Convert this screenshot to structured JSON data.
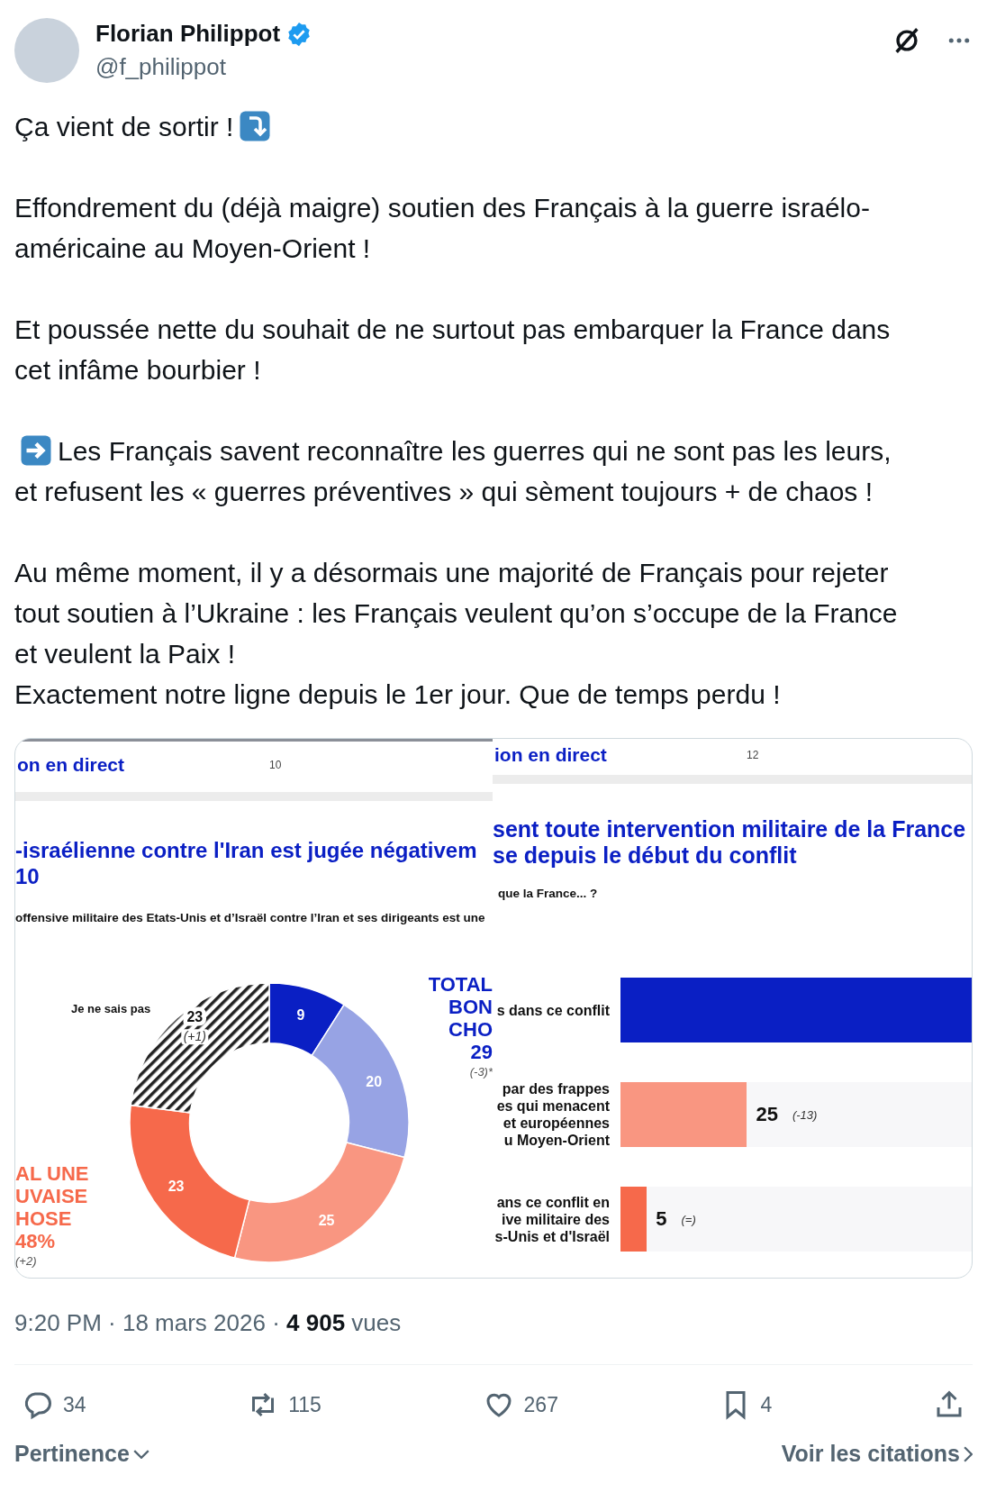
{
  "author": {
    "name": "Florian Philippot",
    "handle": "@f_philippot",
    "verified": true
  },
  "paragraphs": [
    {
      "kind": "lead",
      "lines": [
        "Ça vient de sortir !"
      ]
    },
    {
      "lines": [
        "Effondrement du (déjà maigre) soutien des Français à la guerre israélo-",
        "américaine au Moyen-Orient !"
      ]
    },
    {
      "lines": [
        "Et poussée nette du souhait de ne surtout pas embarquer la France dans",
        "cet infâme bourbier !"
      ]
    },
    {
      "kind": "bullet",
      "lines": [
        "Les Français savent reconnaître les guerres qui ne sont pas les leurs,",
        "et refusent les « guerres préventives » qui sèment toujours + de chaos !"
      ]
    },
    {
      "lines": [
        "Au même moment, il y a désormais une majorité de Français pour rejeter",
        "tout soutien à l’Ukraine : les Français veulent qu’on s’occupe de la France",
        "et veulent la Paix !",
        "Exactement notre ligne depuis le 1er jour. Que de temps perdu !"
      ]
    }
  ],
  "media": [
    {
      "kind": "donut",
      "header": "on en direct",
      "page": "10",
      "title_lines": [
        "-israélienne contre l'Iran est jugée négativem",
        "10"
      ],
      "question": "offensive militaire des Etats-Unis et d’Israël contre l’Iran et ses dirigeants est une",
      "left_total": {
        "lines": [
          "AL UNE",
          "UVAISE",
          "HOSE",
          "48%"
        ],
        "change": "(+2)"
      },
      "right_total": {
        "lines": [
          "TOTAL",
          "BON",
          "CHO",
          "29"
        ],
        "change": "(-3)*"
      },
      "unknown_label": "Je ne sais pas",
      "unknown_change": "(+1)",
      "chart_data": {
        "type": "donut",
        "values": [
          9,
          20,
          25,
          23,
          23
        ],
        "colors": [
          "#0a1fc4",
          "#97a3e4",
          "#f99681",
          "#f6694b",
          "hatched"
        ],
        "data_labels": true
      }
    },
    {
      "kind": "bars",
      "header": "ion en direct",
      "page": "12",
      "title_lines": [
        "sent toute intervention militaire de la France",
        "se depuis le début du conflit"
      ],
      "question": "que la France... ?",
      "rows": [
        {
          "lines": [
            "s dans ce conflit"
          ],
          "level": 1,
          "color": "#0a1fc4"
        },
        {
          "lines": [
            "par des frappes",
            "es qui menacent",
            "et européennes",
            "u Moyen-Orient"
          ],
          "level": 0.36,
          "color": "#f99681",
          "value": "25",
          "change": "(-13)"
        },
        {
          "lines": [
            "ans ce conflit en",
            "ive militaire des",
            "s-Unis et d'Israël"
          ],
          "level": 0.075,
          "color": "#f6694b",
          "value": "5",
          "change": "(=)"
        }
      ]
    }
  ],
  "meta": "9:20 PM · 18 mars 2026 · **4 905** vues",
  "actions": [
    {
      "kind": "reply",
      "count": "34"
    },
    {
      "kind": "repost",
      "count": "115"
    },
    {
      "kind": "like",
      "count": "267"
    },
    {
      "kind": "bookmark",
      "count": "4"
    },
    {
      "kind": "share"
    }
  ],
  "footer": {
    "sort": "Pertinence",
    "quotes": "Voir les citations"
  }
}
